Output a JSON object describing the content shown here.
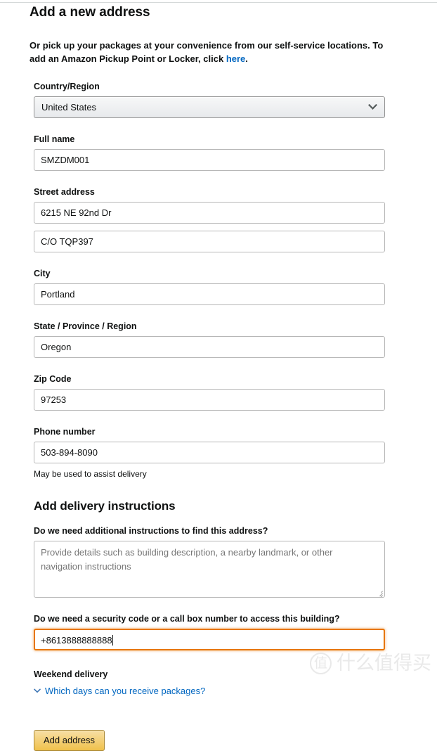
{
  "page": {
    "title": "Add a new address",
    "subtitle_before_link": "Or pick up your packages at your convenience from our self-service locations. To add an Amazon Pickup Point or Locker, click ",
    "subtitle_link": "here",
    "subtitle_after_link": "."
  },
  "form": {
    "country": {
      "label": "Country/Region",
      "value": "United States",
      "caret_icon": "chevron-down-icon"
    },
    "full_name": {
      "label": "Full name",
      "value": "SMZDM001"
    },
    "street_address": {
      "label": "Street address",
      "line1": "6215 NE 92nd Dr",
      "line2": "C/O TQP397"
    },
    "city": {
      "label": "City",
      "value": "Portland"
    },
    "state": {
      "label": "State / Province / Region",
      "value": "Oregon"
    },
    "zip": {
      "label": "Zip Code",
      "value": "97253"
    },
    "phone": {
      "label": "Phone number",
      "value": "503-894-8090",
      "hint": "May be used to assist delivery"
    }
  },
  "delivery_instructions": {
    "section_title": "Add delivery instructions",
    "address_question": "Do we need additional instructions to find this address?",
    "address_placeholder": "Provide details such as building description, a nearby landmark, or other navigation instructions",
    "security_question": "Do we need a security code or a call box number to access this building?",
    "security_value": "+8613888888888"
  },
  "weekend": {
    "title": "Weekend delivery",
    "expander_label": "Which days can you receive packages?",
    "expander_icon": "chevron-down-icon"
  },
  "actions": {
    "submit_label": "Add address"
  },
  "watermark": {
    "badge": "值",
    "text": "什么值得买"
  },
  "colors": {
    "link": "#0066c0",
    "focus_ring": "#e77600",
    "button_gold": "#f0c14b",
    "button_border": "#a88734",
    "input_border": "#b7b7b7",
    "text": "#0f1111",
    "placeholder": "#767676"
  }
}
